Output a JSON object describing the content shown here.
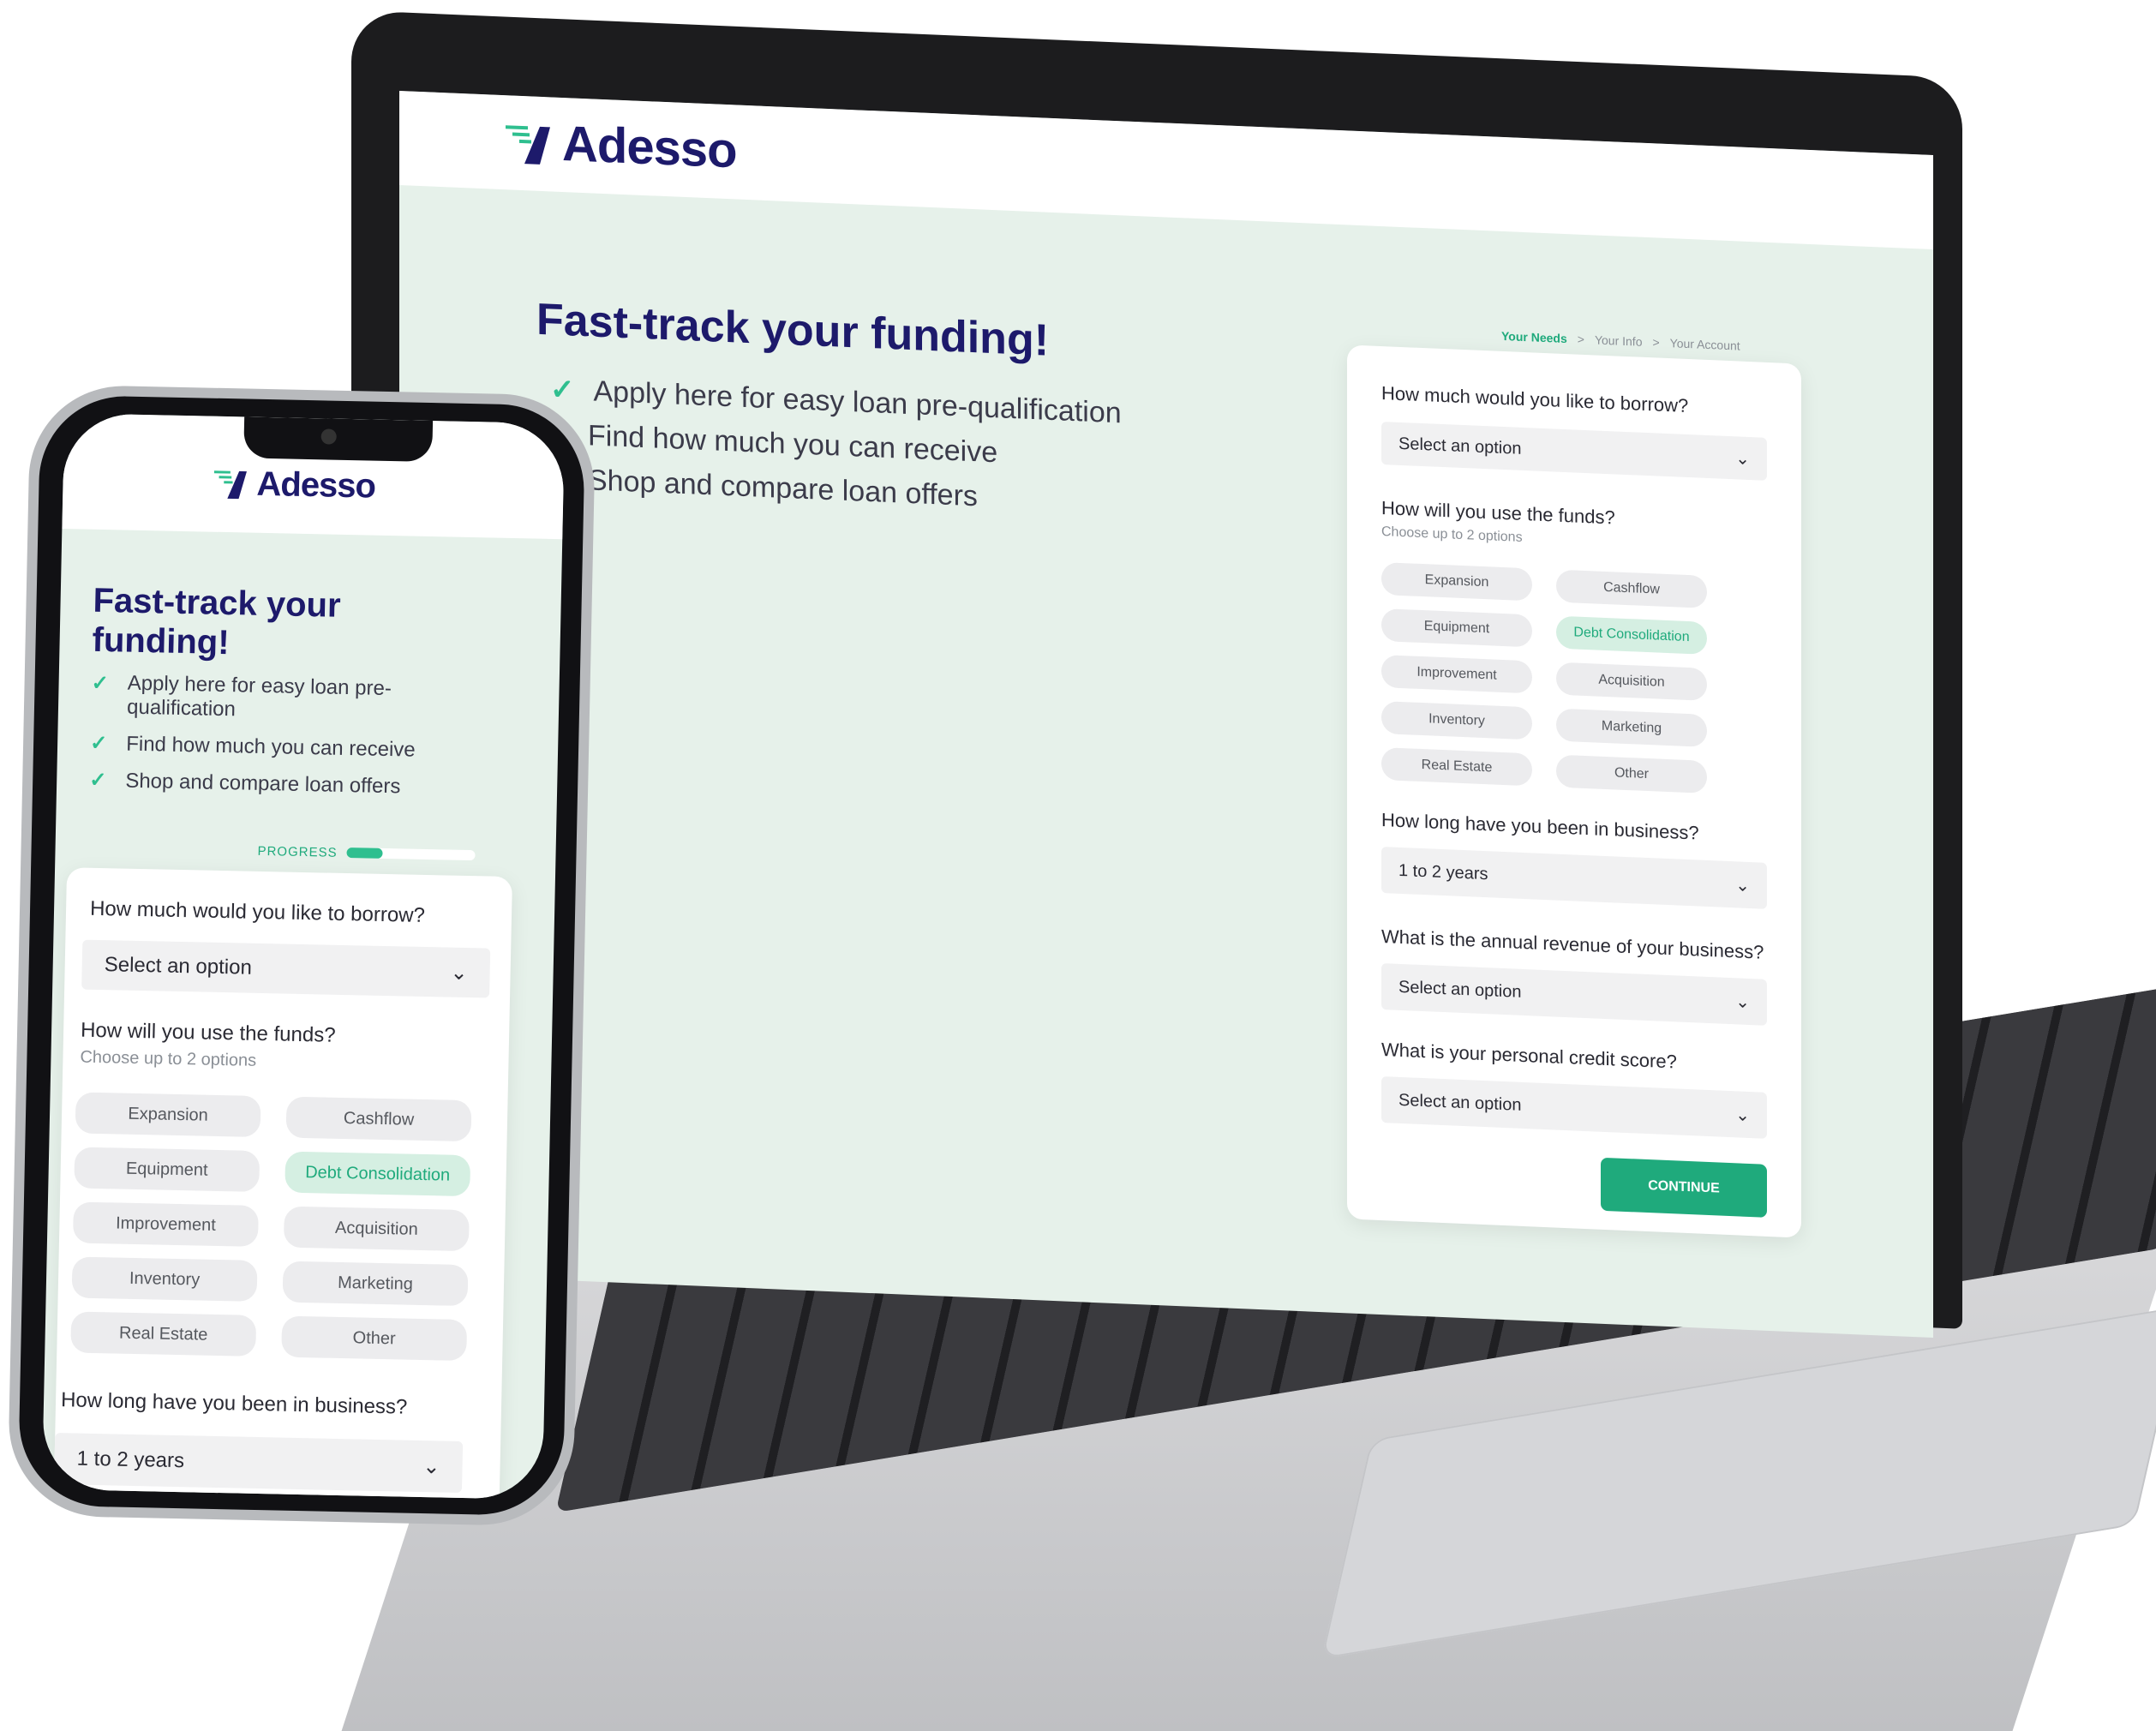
{
  "brand": {
    "name": "Adesso",
    "name_display": "Adesso"
  },
  "colors": {
    "navy": "#1d1a6b",
    "accent": "#1faa7c",
    "background": "#e6f1ea"
  },
  "laptop": {
    "breadcrumb": {
      "step1": "Your Needs",
      "sep1": ">",
      "step2": "Your Info",
      "sep2": ">",
      "step3": "Your Account"
    },
    "headline": "Fast-track your funding!",
    "bullets": [
      "Apply here for easy loan pre-qualification",
      "Find how much you can receive",
      "Shop and compare loan offers"
    ],
    "form": {
      "borrow_label": "How much would you like to borrow?",
      "borrow_value": "Select an option",
      "funds_label": "How will you use the funds?",
      "funds_hint": "Choose up to 2 options",
      "chips": [
        "Expansion",
        "Cashflow",
        "Equipment",
        "Debt Consolidation",
        "Improvement",
        "Acquisition",
        "Inventory",
        "Marketing",
        "Real Estate",
        "Other"
      ],
      "selected_chip": "Debt Consolidation",
      "business_label": "How long have you been in business?",
      "business_value": "1 to 2 years",
      "revenue_label": "What is the annual revenue of your business?",
      "revenue_value": "Select an option",
      "credit_label": "What is your personal credit score?",
      "credit_value": "Select an option",
      "continue_label": "CONTINUE"
    }
  },
  "phone": {
    "headline_line1": "Fast-track your",
    "headline_line2": "funding!",
    "bullets": [
      "Apply here for easy loan pre-qualification",
      "Find how much you can receive",
      "Shop and compare loan offers"
    ],
    "progress_label": "PROGRESS",
    "progress_fraction": 0.28,
    "form": {
      "borrow_label": "How much would you like to borrow?",
      "borrow_value": "Select an option",
      "funds_label": "How will you use the funds?",
      "funds_hint": "Choose up to 2 options",
      "chips": [
        "Expansion",
        "Cashflow",
        "Equipment",
        "Debt Consolidation",
        "Improvement",
        "Acquisition",
        "Inventory",
        "Marketing",
        "Real Estate",
        "Other"
      ],
      "business_label": "How long have you been in business?",
      "business_value": "1 to 2 years"
    }
  },
  "icons": {
    "check": "check-icon",
    "chevron": "chevron-down-icon",
    "logo": "adesso-logo-mark"
  }
}
